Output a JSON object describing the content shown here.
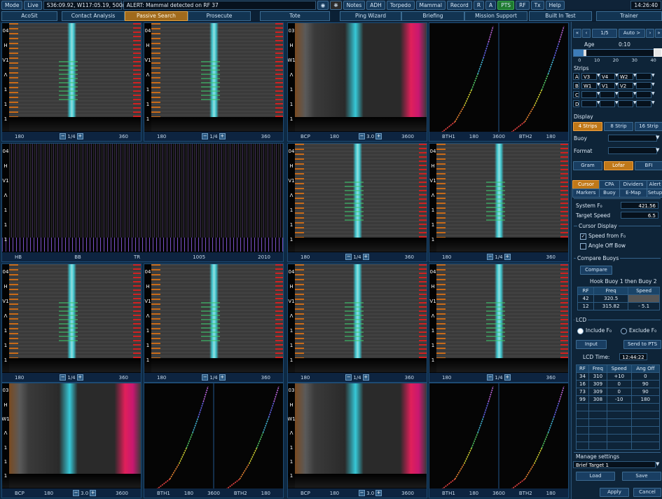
{
  "topbar": {
    "mode": "Mode",
    "live": "Live",
    "position": "S36:09.92, W117:05.19, 500m",
    "alert": "ALERT: Mammal detected on RF 37",
    "buttons": [
      "Notes",
      "ADH",
      "Torpedo",
      "Mammal",
      "Record",
      "R",
      "A",
      "PTS",
      "RF",
      "Tx",
      "Help"
    ],
    "clock": "14:26:40"
  },
  "nav": {
    "tabs": [
      "AcoSit",
      "Contact Analysis",
      "Passive Search",
      "Prosecute",
      "Tote",
      "Ping Wizard",
      "Briefing",
      "Mission Support",
      "Built In Test",
      "Trainer"
    ],
    "active": "Passive Search"
  },
  "panels": {
    "left_labels": [
      "04",
      "H",
      "V1",
      "Λ",
      "1",
      "1",
      "1",
      "1"
    ],
    "w_labels": [
      "03",
      "H",
      "W1",
      "Λ",
      "1",
      "1",
      "1",
      "1"
    ],
    "axis_180": "180",
    "axis_360": "360",
    "axis_3600": "3600",
    "zoom_14": "1/4",
    "zoom_30": "3.0",
    "bcp": "BCP",
    "bth1": "BTH1",
    "bth2": "BTH2",
    "lofar_axis": [
      "HB",
      "BB",
      "TR",
      "1005",
      "2010"
    ]
  },
  "right": {
    "pager": "1/5",
    "auto": "Auto >",
    "age_label": "Age",
    "age_value": "0:10",
    "age_ticks": [
      "0",
      "10",
      "20",
      "30",
      "40"
    ],
    "strips_label": "Strips",
    "strips": [
      {
        "row": "A",
        "c1": "V3",
        "c2": "V4",
        "c3": "W2"
      },
      {
        "row": "B",
        "c1": "W1",
        "c2": "V1",
        "c3": "V2"
      },
      {
        "row": "C",
        "c1": "",
        "c2": "",
        "c3": ""
      },
      {
        "row": "D",
        "c1": "",
        "c2": "",
        "c3": ""
      }
    ],
    "display_label": "Display",
    "display_opts": [
      "4 Strips",
      "8 Strip",
      "16 Strip"
    ],
    "buoy_label": "Buoy",
    "format_label": "Format",
    "gram_opts": [
      "Gram",
      "Lofar",
      "BFI"
    ],
    "tabs_row1": [
      "Cursor",
      "CPA",
      "Dividers",
      "Alert"
    ],
    "tabs_row2": [
      "Markers",
      "Buoy",
      "E-Map",
      "Setup"
    ],
    "system_f_label": "System F₀",
    "system_f_value": "421.56",
    "target_speed_label": "Target Speed",
    "target_speed_value": "6.5",
    "cursor_display_label": "Cursor Display",
    "speed_from_f": "Speed from F₀",
    "angle_off_bow": "Angle Off Bow",
    "compare_buoys_label": "Compare Buoys",
    "compare_btn": "Compare",
    "hook_text": "Hook Buoy 1 then Buoy 2",
    "compare_headers": [
      "RF",
      "Freq",
      "Speed"
    ],
    "compare_rows": [
      [
        "42",
        "320.5",
        ""
      ],
      [
        "12",
        "315.82",
        "- 5.1"
      ]
    ],
    "lcd_label": "LCD",
    "include_f": "Include F₀",
    "exclude_f": "Exclude F₀",
    "input_btn": "Input",
    "send_pts_btn": "Send to PTS",
    "lcd_time_label": "LCD Time:",
    "lcd_time_value": "12:44:22",
    "lcd_headers": [
      "RF",
      "Freq",
      "Speed",
      "Ang Off"
    ],
    "lcd_rows": [
      [
        "34",
        "310",
        "+10",
        "0"
      ],
      [
        "16",
        "309",
        "0",
        "90"
      ],
      [
        "73",
        "309",
        "0",
        "90"
      ],
      [
        "99",
        "308",
        "-10",
        "180"
      ]
    ],
    "manage_label": "Manage settings",
    "manage_value": "Brief Target 1",
    "load_btn": "Load",
    "save_btn": "Save",
    "apply_btn": "Apply",
    "cancel_btn": "Cancel"
  },
  "colors": {
    "accent_orange": "#c07818",
    "active_green": "#1f7a30",
    "cyan_trace": "#3fd6e0"
  }
}
